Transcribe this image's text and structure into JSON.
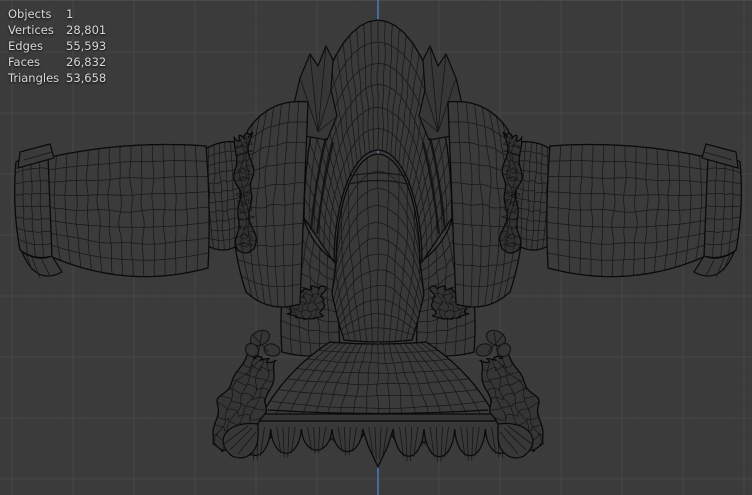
{
  "viewport": {
    "stats": {
      "rows": [
        {
          "label": "Objects",
          "value": "1"
        },
        {
          "label": "Vertices",
          "value": "28,801"
        },
        {
          "label": "Edges",
          "value": "55,593"
        },
        {
          "label": "Faces",
          "value": "26,832"
        },
        {
          "label": "Triangles",
          "value": "53,658"
        }
      ]
    }
  },
  "colors": {
    "background": "#3b3b3b",
    "grid_major": "#474747",
    "grid_minor": "#424242",
    "axis_z": "#4876b6",
    "wire": "#161616",
    "wire_outline": "#0a0a0a",
    "mesh_fill": "#3a3a3a",
    "mesh_fill_mid": "#383838",
    "mesh_fill_dark": "#343434",
    "overlay_text": "#d8d8d8"
  }
}
